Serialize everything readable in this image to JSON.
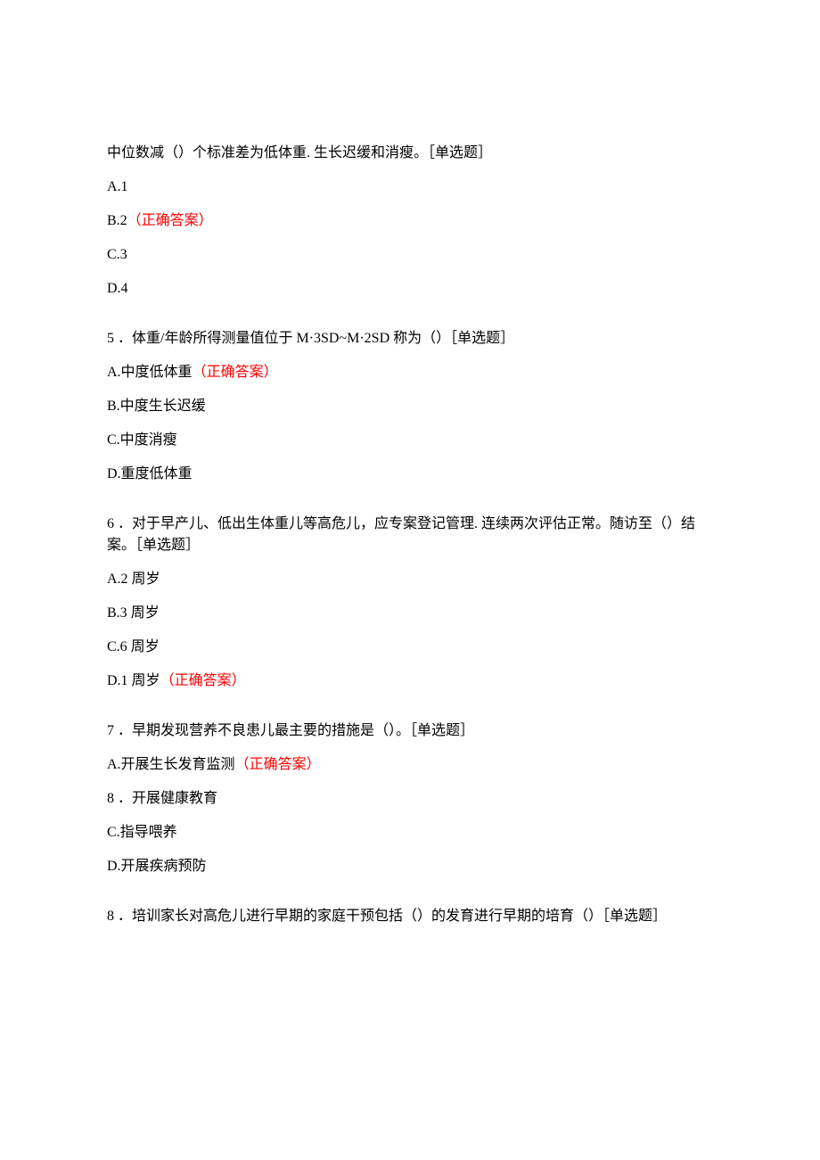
{
  "q4": {
    "stem": "中位数减（）个标准差为低体重. 生长迟缓和消瘦。［单选题］",
    "optA": "A.1",
    "optB_prefix": "B.2",
    "correct": "（正确答案）",
    "optC": "C.3",
    "optD": "D.4"
  },
  "q5": {
    "stem": "5 ．体重/年龄所得测量值位于 M·3SD~M·2SD 称为（）［单选题］",
    "optA_prefix": "A.中度低体重",
    "correct": "（正确答案）",
    "optB": "B.中度生长迟缓",
    "optC": "C.中度消瘦",
    "optD": "D.重度低体重"
  },
  "q6": {
    "stem": "6 ．对于早产儿、低出生体重儿等高危儿，应专案登记管理. 连续两次评估正常。随访至（）结案。［单选题］",
    "optA": "A.2 周岁",
    "optB": "B.3 周岁",
    "optC": "C.6 周岁",
    "optD_prefix": "D.1 周岁",
    "correct": "（正确答案）"
  },
  "q7": {
    "stem": "7 ．早期发现营养不良患儿最主要的措施是（）。［单选题］",
    "optA_prefix": "A.开展生长发育监测",
    "correct": "（正确答案）",
    "optB": "8 ．开展健康教育",
    "optC": "C.指导喂养",
    "optD": "D.开展疾病预防"
  },
  "q8": {
    "stem": "8 ．培训家长对高危儿进行早期的家庭干预包括（）的发育进行早期的培育（）［单选题］"
  }
}
